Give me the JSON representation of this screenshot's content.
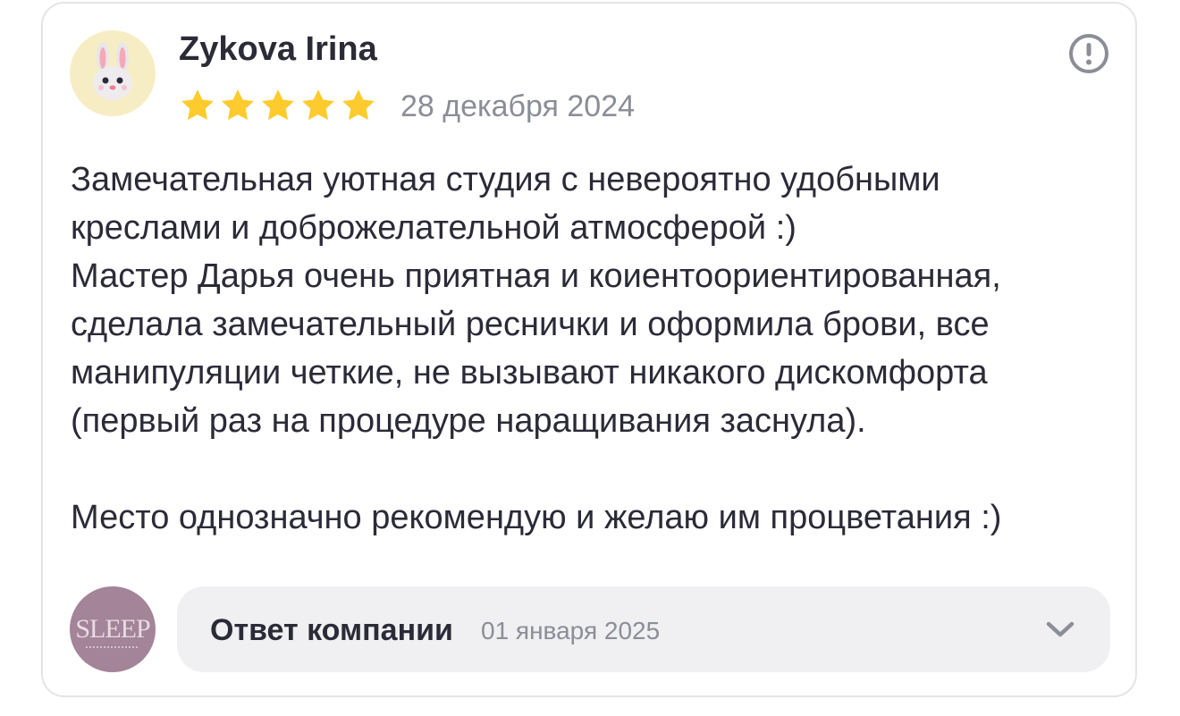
{
  "review": {
    "author": "Zykova Irina",
    "avatar_icon": "bunny-emoji",
    "rating": 5,
    "rating_max": 5,
    "date": "28 декабря 2024",
    "text": "Замечательная уютная студия с невероятно удобными\nкреслами и доброжелательной атмосферой :)\nМастер Дарья очень приятная и коиентоориентированная,\nсделала замечательный реснички и оформила брови, все\nманипуляции четкие, не вызывают никакого дискомфорта\n(первый раз на процедуре наращивания заснула).\n\nМесто однозначно рекомендую и желаю им процветания :)",
    "report_icon": "exclamation-circle-icon"
  },
  "company_reply": {
    "logo_text": "SLEEP",
    "title": "Ответ компании",
    "date": "01 января 2025",
    "expand_icon": "chevron-down-icon"
  },
  "colors": {
    "star": "#fdcb2e",
    "text_primary": "#2b2b38",
    "text_secondary": "#8b8d97",
    "reply_bg": "#f0f0f2",
    "company_avatar_bg": "#a38499",
    "author_avatar_bg": "#f7edc4"
  }
}
